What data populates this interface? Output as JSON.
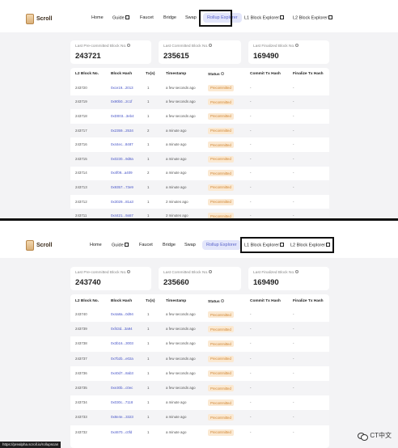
{
  "brand": "Scroll",
  "nav": {
    "home": "Home",
    "guide": "Guide",
    "faucet": "Faucet",
    "bridge": "Bridge",
    "swap": "Swap",
    "rollup": "Rollup Explorer",
    "l1": "L1 Block Explorer",
    "l2": "L2 Block Explorer"
  },
  "cards": {
    "precommitted_label": "Last Pre-committed Block No.",
    "committed_label": "Last Committed Block No.",
    "finalized_label": "Last Finalized Block No."
  },
  "columns": {
    "block_no": "L2 Block No.",
    "block_hash": "Block Hash",
    "txs": "Tx(s)",
    "timestamp": "Timestamp",
    "status": "Status",
    "commit_hash": "Commit Tx Hash",
    "finalize_hash": "Finalize Tx Hash"
  },
  "top": {
    "precommitted_value": "243721",
    "committed_value": "235615",
    "finalized_value": "169490",
    "rows": [
      {
        "no": "243720",
        "hash": "0xce19...2013",
        "txs": "1",
        "time": "a few seconds ago",
        "status": "Precommitted",
        "commit": "-",
        "finalize": "-"
      },
      {
        "no": "243719",
        "hash": "0x90b0...2c1f",
        "txs": "1",
        "time": "a few seconds ago",
        "status": "Precommitted",
        "commit": "-",
        "finalize": "-"
      },
      {
        "no": "243718",
        "hash": "0xD003...3eb4",
        "txs": "1",
        "time": "a few seconds ago",
        "status": "Precommitted",
        "commit": "-",
        "finalize": "-"
      },
      {
        "no": "243717",
        "hash": "0x2359...2534",
        "txs": "2",
        "time": "a minute ago",
        "status": "Precommitted",
        "commit": "-",
        "finalize": "-"
      },
      {
        "no": "243716",
        "hash": "0x44ec...8487",
        "txs": "1",
        "time": "a minute ago",
        "status": "Precommitted",
        "commit": "-",
        "finalize": "-"
      },
      {
        "no": "243715",
        "hash": "0x0230...9d8a",
        "txs": "1",
        "time": "a minute ago",
        "status": "Precommitted",
        "commit": "-",
        "finalize": "-"
      },
      {
        "no": "243714",
        "hash": "0x4f09...a409",
        "txs": "2",
        "time": "a minute ago",
        "status": "Precommitted",
        "commit": "-",
        "finalize": "-"
      },
      {
        "no": "243713",
        "hash": "0x9357...73e9",
        "txs": "1",
        "time": "a minute ago",
        "status": "Precommitted",
        "commit": "-",
        "finalize": "-"
      },
      {
        "no": "243712",
        "hash": "0x3029...81a3",
        "txs": "1",
        "time": "2 minutes ago",
        "status": "Precommitted",
        "commit": "-",
        "finalize": "-"
      },
      {
        "no": "243711",
        "hash": "0x4421...9a57",
        "txs": "1",
        "time": "2 minutes ago",
        "status": "Precommitted",
        "commit": "-",
        "finalize": "-"
      }
    ]
  },
  "bottom": {
    "precommitted_value": "243740",
    "committed_value": "235660",
    "finalized_value": "169490",
    "rows": [
      {
        "no": "243740",
        "hash": "0x4a8a...0d94",
        "txs": "1",
        "time": "a few seconds ago",
        "status": "Precommitted",
        "commit": "-",
        "finalize": "-"
      },
      {
        "no": "243739",
        "hash": "0xf43d...3a94",
        "txs": "1",
        "time": "a few seconds ago",
        "status": "Precommitted",
        "commit": "-",
        "finalize": "-"
      },
      {
        "no": "243738",
        "hash": "0x3b16...3003",
        "txs": "1",
        "time": "a few seconds ago",
        "status": "Precommitted",
        "commit": "-",
        "finalize": "-"
      },
      {
        "no": "243737",
        "hash": "0x7b2b...e02a",
        "txs": "1",
        "time": "a few seconds ago",
        "status": "Precommitted",
        "commit": "-",
        "finalize": "-"
      },
      {
        "no": "243736",
        "hash": "0x40d7...8ab3",
        "txs": "1",
        "time": "a few seconds ago",
        "status": "Precommitted",
        "commit": "-",
        "finalize": "-"
      },
      {
        "no": "243735",
        "hash": "0xe30b...c0ec",
        "txs": "1",
        "time": "a few seconds ago",
        "status": "Precommitted",
        "commit": "-",
        "finalize": "-"
      },
      {
        "no": "243734",
        "hash": "0x030c...7118",
        "txs": "1",
        "time": "a minute ago",
        "status": "Precommitted",
        "commit": "-",
        "finalize": "-"
      },
      {
        "no": "243733",
        "hash": "0x8e4e...3323",
        "txs": "1",
        "time": "a minute ago",
        "status": "Precommitted",
        "commit": "-",
        "finalize": "-"
      },
      {
        "no": "243732",
        "hash": "0x4670...c0fd",
        "txs": "1",
        "time": "a minute ago",
        "status": "Precommitted",
        "commit": "-",
        "finalize": "-"
      }
    ]
  },
  "status_url": "https://prealpha.scroll.io/rollupscan",
  "watermark": "CT中文",
  "icons": {
    "logo": "scroll-logo-icon",
    "external": "external-link-icon",
    "info": "info-icon",
    "watermark": "wechat-icon"
  },
  "colors": {
    "accent": "#5963c9",
    "active_bg": "#e3e6fb",
    "badge_bg": "#fbe9d2",
    "badge_text": "#d08430",
    "hash_link": "#4a57c8"
  }
}
